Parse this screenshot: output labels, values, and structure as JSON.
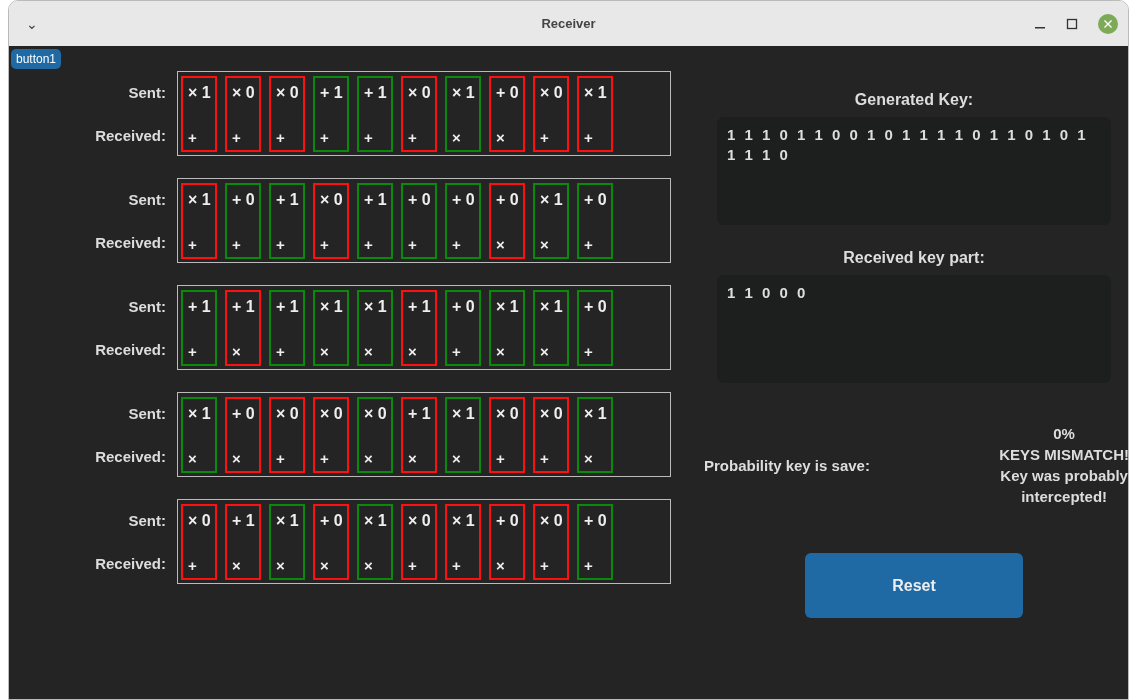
{
  "window": {
    "title": "Receiver",
    "menu_glyph": "⌄"
  },
  "corner_button": "button1",
  "rows": [
    {
      "sent_label": "Sent:",
      "received_label": "Received:",
      "cells": [
        {
          "sent": "× 1",
          "received": "+",
          "match": false
        },
        {
          "sent": "× 0",
          "received": "+",
          "match": false
        },
        {
          "sent": "× 0",
          "received": "+",
          "match": false
        },
        {
          "sent": "+ 1",
          "received": "+",
          "match": true
        },
        {
          "sent": "+ 1",
          "received": "+",
          "match": true
        },
        {
          "sent": "× 0",
          "received": "+",
          "match": false
        },
        {
          "sent": "× 1",
          "received": "×",
          "match": true
        },
        {
          "sent": "+ 0",
          "received": "×",
          "match": false
        },
        {
          "sent": "× 0",
          "received": "+",
          "match": false
        },
        {
          "sent": "× 1",
          "received": "+",
          "match": false
        }
      ]
    },
    {
      "sent_label": "Sent:",
      "received_label": "Received:",
      "cells": [
        {
          "sent": "× 1",
          "received": "+",
          "match": false
        },
        {
          "sent": "+ 0",
          "received": "+",
          "match": true
        },
        {
          "sent": "+ 1",
          "received": "+",
          "match": true
        },
        {
          "sent": "× 0",
          "received": "+",
          "match": false
        },
        {
          "sent": "+ 1",
          "received": "+",
          "match": true
        },
        {
          "sent": "+ 0",
          "received": "+",
          "match": true
        },
        {
          "sent": "+ 0",
          "received": "+",
          "match": true
        },
        {
          "sent": "+ 0",
          "received": "×",
          "match": false
        },
        {
          "sent": "× 1",
          "received": "×",
          "match": true
        },
        {
          "sent": "+ 0",
          "received": "+",
          "match": true
        }
      ]
    },
    {
      "sent_label": "Sent:",
      "received_label": "Received:",
      "cells": [
        {
          "sent": "+ 1",
          "received": "+",
          "match": true
        },
        {
          "sent": "+ 1",
          "received": "×",
          "match": false
        },
        {
          "sent": "+ 1",
          "received": "+",
          "match": true
        },
        {
          "sent": "× 1",
          "received": "×",
          "match": true
        },
        {
          "sent": "× 1",
          "received": "×",
          "match": true
        },
        {
          "sent": "+ 1",
          "received": "×",
          "match": false
        },
        {
          "sent": "+ 0",
          "received": "+",
          "match": true
        },
        {
          "sent": "× 1",
          "received": "×",
          "match": true
        },
        {
          "sent": "× 1",
          "received": "×",
          "match": true
        },
        {
          "sent": "+ 0",
          "received": "+",
          "match": true
        }
      ]
    },
    {
      "sent_label": "Sent:",
      "received_label": "Received:",
      "cells": [
        {
          "sent": "× 1",
          "received": "×",
          "match": true
        },
        {
          "sent": "+ 0",
          "received": "×",
          "match": false
        },
        {
          "sent": "× 0",
          "received": "+",
          "match": false
        },
        {
          "sent": "× 0",
          "received": "+",
          "match": false
        },
        {
          "sent": "× 0",
          "received": "×",
          "match": true
        },
        {
          "sent": "+ 1",
          "received": "×",
          "match": false
        },
        {
          "sent": "× 1",
          "received": "×",
          "match": true
        },
        {
          "sent": "× 0",
          "received": "+",
          "match": false
        },
        {
          "sent": "× 0",
          "received": "+",
          "match": false
        },
        {
          "sent": "× 1",
          "received": "×",
          "match": true
        }
      ]
    },
    {
      "sent_label": "Sent:",
      "received_label": "Received:",
      "cells": [
        {
          "sent": "× 0",
          "received": "+",
          "match": false
        },
        {
          "sent": "+ 1",
          "received": "×",
          "match": false
        },
        {
          "sent": "× 1",
          "received": "×",
          "match": true
        },
        {
          "sent": "+ 0",
          "received": "×",
          "match": false
        },
        {
          "sent": "× 1",
          "received": "×",
          "match": true
        },
        {
          "sent": "× 0",
          "received": "+",
          "match": false
        },
        {
          "sent": "× 1",
          "received": "+",
          "match": false
        },
        {
          "sent": "+ 0",
          "received": "×",
          "match": false
        },
        {
          "sent": "× 0",
          "received": "+",
          "match": false
        },
        {
          "sent": "+ 0",
          "received": "+",
          "match": true
        }
      ]
    }
  ],
  "generated_key": {
    "label": "Generated Key:",
    "value": "1 1 1 0 1 1 0 0 1 0 1 1 1 1 0 1 1 0 1 0 1 1 1 1 0"
  },
  "received_key": {
    "label": "Received key part:",
    "value": "1 1 0 0 0"
  },
  "probability": {
    "label": "Probability key is save:",
    "lines": [
      "0%",
      "KEYS MISMATCH!",
      "Key was probably",
      "intercepted!"
    ]
  },
  "reset_button": "Reset"
}
